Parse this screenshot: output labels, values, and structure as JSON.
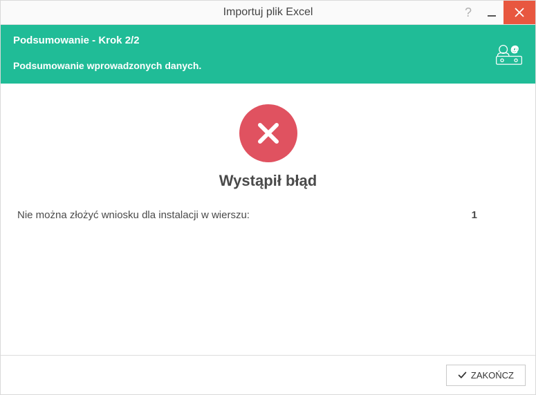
{
  "titlebar": {
    "title": "Importuj plik Excel"
  },
  "header": {
    "step": "Podsumowanie - Krok 2/2",
    "subtitle": "Podsumowanie wprowadzonych danych."
  },
  "content": {
    "error_title": "Wystąpił błąd",
    "error_message": "Nie można złożyć wniosku dla instalacji w wierszu:",
    "error_row": "1"
  },
  "footer": {
    "finish_label": "ZAKOŃCZ"
  }
}
